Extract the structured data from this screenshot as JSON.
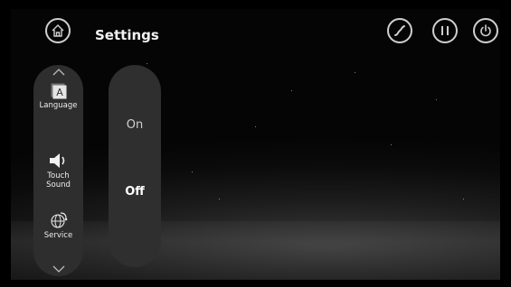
{
  "header": {
    "title": "Settings",
    "home_icon": "home-icon",
    "action_icons": [
      "massage-curve-icon",
      "pause-icon",
      "power-icon"
    ]
  },
  "menu": {
    "scroll_up_icon": "chevron-up-icon",
    "scroll_down_icon": "chevron-down-icon",
    "items": [
      {
        "label": "Language",
        "icon": "language-icon"
      },
      {
        "label": "Touch\nSound",
        "icon": "speaker-icon"
      },
      {
        "label": "Service",
        "icon": "service-globe-icon"
      }
    ]
  },
  "options": {
    "items": [
      {
        "label": "On",
        "selected": false
      },
      {
        "label": "Off",
        "selected": true
      }
    ]
  },
  "colors": {
    "background": "#000000",
    "panel": "#2e2e2e",
    "text": "#f2f2f2",
    "icon_stroke": "#cfcfcf"
  }
}
